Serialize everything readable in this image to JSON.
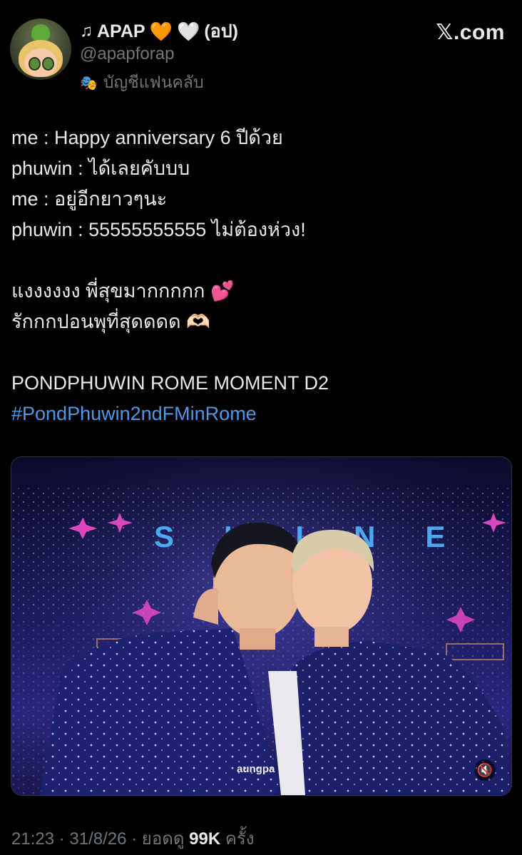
{
  "profile": {
    "note_icon": "♫",
    "display_name": "APAP",
    "hearts": [
      "🧡",
      "🤍"
    ],
    "name_suffix": "(อป)",
    "handle": "@apapforap",
    "fan_icon": "mask-icon",
    "fan_label": "บัญชีแฟนคลับ"
  },
  "brand": {
    "label": "𝕏.com"
  },
  "tweet": {
    "lines": [
      "me : Happy anniversary 6 ปีด้วย",
      "phuwin : ได้เลยคับบบ",
      "me : อยู่อีกยาวๆนะ",
      "phuwin : 55555555555 ไม่ต้องห่วง!"
    ],
    "line5_text": "แงงงงงง พี่สุขมากกกกก",
    "line5_emoji": "💕",
    "line6_text": "รักกกปอนพุที่สุดดดด",
    "line6_emoji": "🫶🏻",
    "line7": "PONDPHUWIN ROME MOMENT D2",
    "hashtag": "#PondPhuwin2ndFMinRome"
  },
  "media": {
    "watermark": "aungpa",
    "mute_icon": "🔇",
    "stage_sign": "SHINE"
  },
  "meta": {
    "time": "21:23",
    "sep1": " · ",
    "date": "31/8/26",
    "sep2": " · ",
    "views_prefix": "ยอดดู ",
    "views_count": "99K",
    "views_suffix": " ครั้ง"
  },
  "colors": {
    "background": "#000000",
    "text": "#e7e9ea",
    "muted": "#71767b",
    "link": "#4a9ae8"
  }
}
